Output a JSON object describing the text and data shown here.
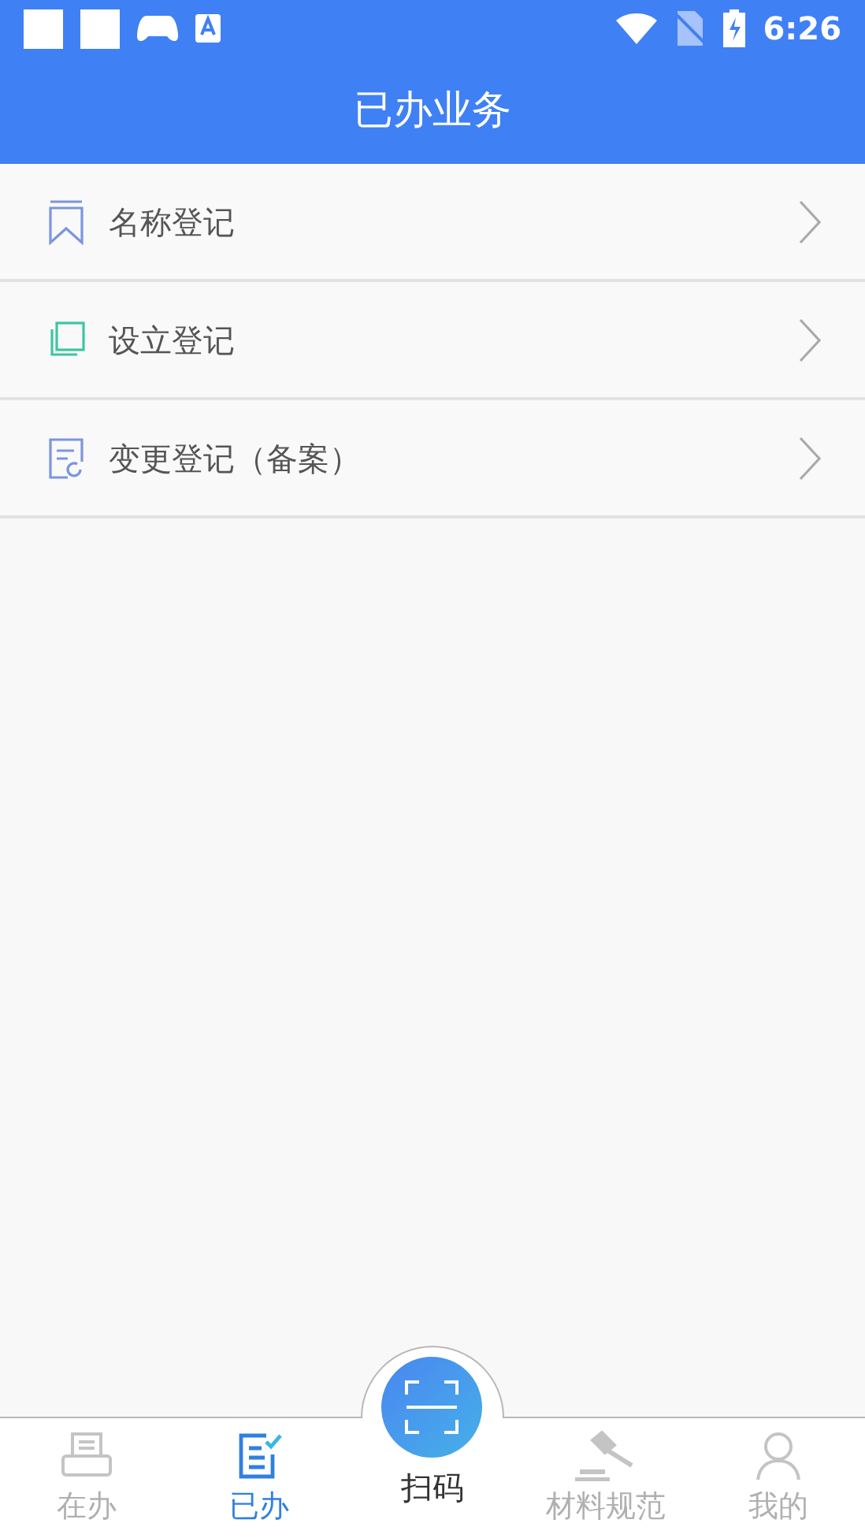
{
  "status_bar": {
    "time": "6:26"
  },
  "header": {
    "title": "已办业务"
  },
  "list": [
    {
      "label": "名称登记"
    },
    {
      "label": "设立登记"
    },
    {
      "label": "变更登记（备案）"
    }
  ],
  "tab_bar": [
    {
      "label": "在办",
      "kind": "tab",
      "selected": false
    },
    {
      "label": "已办",
      "kind": "tab",
      "selected": true
    },
    {
      "label": "扫码",
      "kind": "scan",
      "selected": false
    },
    {
      "label": "材料规范",
      "kind": "tab",
      "selected": false
    },
    {
      "label": "我的",
      "kind": "tab",
      "selected": false
    }
  ]
}
